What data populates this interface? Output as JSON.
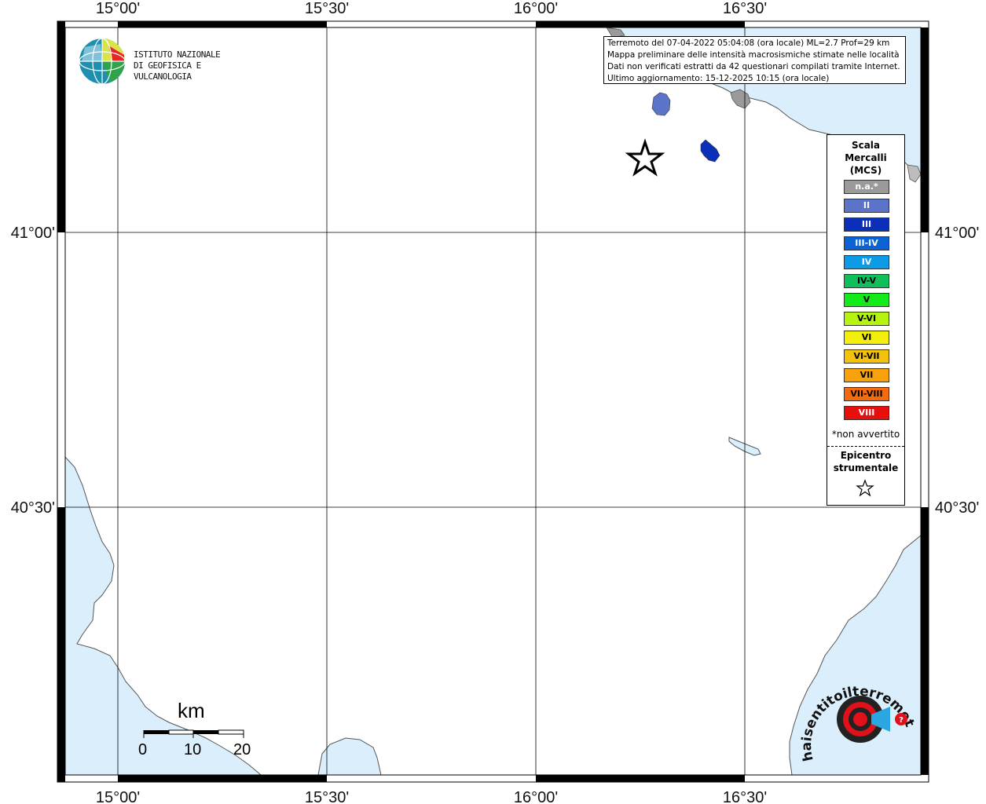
{
  "map": {
    "longitude_labels": [
      "15°00'",
      "15°30'",
      "16°00'",
      "16°30'"
    ],
    "latitude_labels": [
      "41°00'",
      "40°30'"
    ],
    "colors": {
      "sea": "#dbeefb",
      "land": "#ffffff",
      "grid": "#000000",
      "frame": "#000000"
    }
  },
  "organization": {
    "logo_icon": "globe-logo-icon",
    "name_line1": "ISTITUTO NAZIONALE",
    "name_line2": "DI GEOFISICA E VULCANOLOGIA"
  },
  "info": {
    "line1": "Terremoto del 07-04-2022 05:04:08 (ora locale) ML=2.7 Prof=29 km",
    "line2": "Mappa preliminare delle intensità macrosismiche stimate nelle località",
    "line3": "Dati non verificati estratti da 42 questionari compilati tramite Internet.",
    "line4": "Ultimo aggiornamento: 15-12-2025 10:15 (ora locale)"
  },
  "legend": {
    "title_line1": "Scala",
    "title_line2": "Mercalli",
    "title_line3": "(MCS)",
    "items": [
      {
        "label": "n.a.*",
        "color": "#9a9a9a",
        "text_color": "#ffffff"
      },
      {
        "label": "II",
        "color": "#5b74c9",
        "text_color": "#ffffff"
      },
      {
        "label": "III",
        "color": "#0a2fb8",
        "text_color": "#ffffff"
      },
      {
        "label": "III-IV",
        "color": "#0d62d3",
        "text_color": "#ffffff"
      },
      {
        "label": "IV",
        "color": "#0c9be6",
        "text_color": "#ffffff"
      },
      {
        "label": "IV-V",
        "color": "#10bf5a",
        "text_color": "#000000"
      },
      {
        "label": "V",
        "color": "#13ea1a",
        "text_color": "#000000"
      },
      {
        "label": "V-VI",
        "color": "#b5f311",
        "text_color": "#000000"
      },
      {
        "label": "VI",
        "color": "#f2f00a",
        "text_color": "#000000"
      },
      {
        "label": "VI-VII",
        "color": "#f4c20c",
        "text_color": "#000000"
      },
      {
        "label": "VII",
        "color": "#f7a10d",
        "text_color": "#000000"
      },
      {
        "label": "VII-VIII",
        "color": "#f46a0c",
        "text_color": "#000000"
      },
      {
        "label": "VIII",
        "color": "#e60f0c",
        "text_color": "#ffffff"
      }
    ],
    "note": "*non avvertito",
    "epicenter_line1": "Epicentro",
    "epicenter_line2": "strumentale",
    "epicenter_icon": "star-outline-icon"
  },
  "scale_bar": {
    "unit": "km",
    "labels": [
      "0",
      "10",
      "20"
    ]
  },
  "intensity_areas": [
    {
      "intensity": "II",
      "color": "#5b74c9"
    },
    {
      "intensity": "III",
      "color": "#0a2fb8"
    }
  ],
  "watermark": {
    "text": "haisentitoilterremoto.it",
    "icon": "hst-target-logo-icon"
  }
}
